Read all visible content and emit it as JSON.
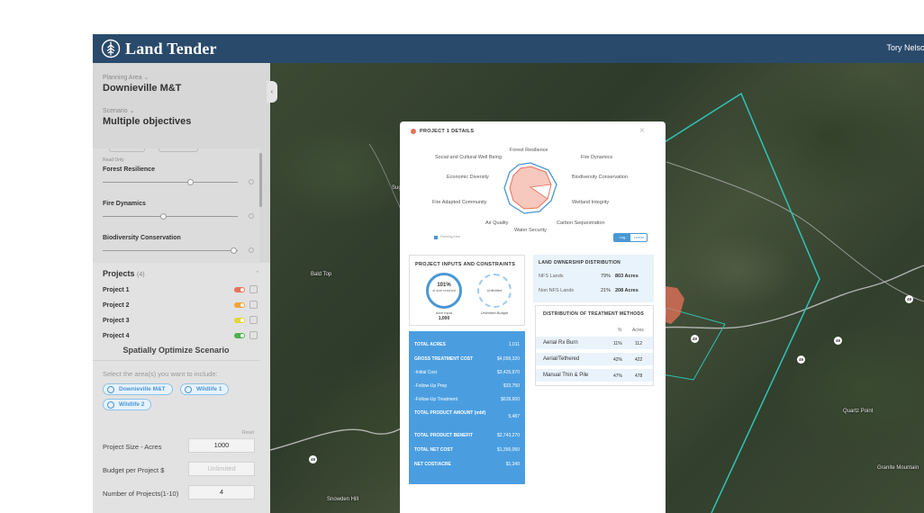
{
  "header": {
    "title": "Land Tender",
    "user_name": "Tory Nelson"
  },
  "sidebar": {
    "planning_area_label": "Planning Area",
    "planning_area_value": "Downieville M&T",
    "scenario_label": "Scenario",
    "scenario_value": "Multiple objectives",
    "read_only_label": "Read Only",
    "criteria": [
      {
        "name": "Forest Resilience",
        "value_fraction": 0.65
      },
      {
        "name": "Fire Dynamics",
        "value_fraction": 0.45
      },
      {
        "name": "Biodiversity Conservation",
        "value_fraction": 0.97
      }
    ],
    "projects_title": "Projects",
    "projects_count": "(4)",
    "projects": [
      {
        "name": "Project 1",
        "color": "#e8715a"
      },
      {
        "name": "Project 2",
        "color": "#f0a43a"
      },
      {
        "name": "Project 3",
        "color": "#e6d43a"
      },
      {
        "name": "Project 4",
        "color": "#4cb34a"
      }
    ],
    "optimize_title": "Spatially Optimize Scenario",
    "select_area_text": "Select the area(s) you want to include:",
    "area_chips": [
      "Downieville M&T",
      "Wildlife 1",
      "Wildlife 2"
    ],
    "reset_label": "Reset",
    "fields": [
      {
        "label": "Project Size - Acres",
        "value": "1000",
        "placeholder": false
      },
      {
        "label": "Budget per Project $",
        "value": "Unlimited",
        "placeholder": true
      },
      {
        "label": "Number of Projects(1-10)",
        "value": "4",
        "placeholder": false
      }
    ]
  },
  "map": {
    "labels": [
      "Bald Top",
      "Snowden Hill",
      "Quartz Point",
      "Granite Mountain",
      "Sugar"
    ],
    "road_badges": [
      "49",
      "49",
      "49",
      "49",
      "49"
    ],
    "accent_color": "#2ec4b6",
    "project_color": "#e8715a"
  },
  "modal": {
    "title": "PROJECT 1 DETAILS",
    "radar_labels": {
      "forest_resilience": "Forest Resilience",
      "social": "Social and Cultural Well Being",
      "fire_dynamics": "Fire Dynamics",
      "economic": "Economic Diversity",
      "biodiversity": "Biodiversity Conservation",
      "fire_adapted": "Fire Adapted Community",
      "wetland": "Wetland Integrity",
      "air_quality": "Air Quality",
      "carbon": "Carbon Sequestration",
      "water": "Water Security"
    },
    "legend_label": "Planning Area",
    "scale_log": "Log",
    "scale_linear": "Linear",
    "inputs_title": "PROJECT INPUTS AND CONSTRAINTS",
    "acre_percent": "101%",
    "acre_reached": "of size reached",
    "budget_ring_text": "Unlimited",
    "acre_input_label": "Acre Input",
    "acre_input_value": "1,000",
    "budget_label": "Unlimited Budget",
    "totals": [
      {
        "label": "TOTAL ACRES",
        "value": "1,011",
        "bold": true
      },
      {
        "label": "GROSS TREATMENT COST",
        "value": "$4,099,320",
        "bold": true
      },
      {
        "label": "-Initial Cost",
        "value": "$3,425,970",
        "bold": false
      },
      {
        "label": "-Follow-Up Prep",
        "value": "$33,750",
        "bold": false
      },
      {
        "label": "-Follow-Up Treatment",
        "value": "$639,600",
        "bold": false
      },
      {
        "label": "TOTAL PRODUCT AMOUNT (mbf)",
        "value": "5,487",
        "bold": true
      },
      {
        "label": "TOTAL PRODUCT BENEFIT",
        "value": "$2,743,270",
        "bold": true
      },
      {
        "label": "TOTAL NET COST",
        "value": "$1,356,050",
        "bold": true
      },
      {
        "label": "NET COST/ACRE",
        "value": "$1,340",
        "bold": true
      }
    ],
    "ownership_title": "LAND OWNERSHIP DISTRIBUTION",
    "ownership": [
      {
        "name": "NFS Lands",
        "percent": "79%",
        "acres": "803 Acres"
      },
      {
        "name": "Non NFS Lands",
        "percent": "21%",
        "acres": "208 Acres"
      }
    ],
    "distribution_title": "DISTRIBUTION OF TREATMENT METHODS",
    "distribution_head_pct": "%",
    "distribution_head_acres": "Acres",
    "distribution": [
      {
        "method": "Aerial Rx Burn",
        "percent": "11%",
        "acres": "112"
      },
      {
        "method": "Aerial/Tethered",
        "percent": "42%",
        "acres": "422"
      },
      {
        "method": "Manual Thin & Pile",
        "percent": "47%",
        "acres": "478"
      }
    ]
  }
}
